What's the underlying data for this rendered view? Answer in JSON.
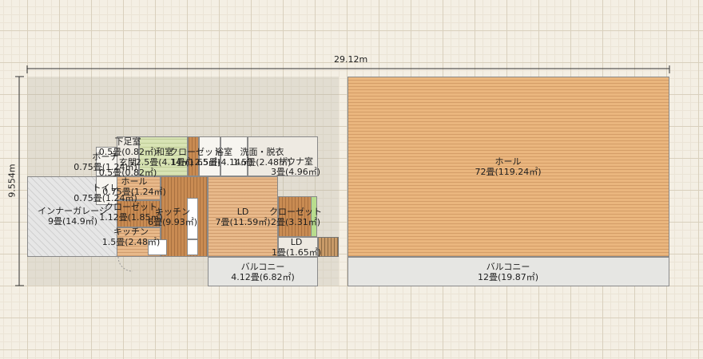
{
  "dimensions": {
    "width_label": "29.12m",
    "height_label": "9.554m"
  },
  "rooms": {
    "inner_garage": {
      "name": "インナーガレージ",
      "area": "9畳(14.9㎡)"
    },
    "toilet": {
      "name": "トイレ",
      "area": "0.75畳(1.24㎡)"
    },
    "porch": {
      "name": "ポーチ",
      "area": "0.75畳(1.24㎡)"
    },
    "shoe_room": {
      "name": "下足室",
      "area": "0.5畳(0.82㎡)"
    },
    "entrance": {
      "name": "玄関",
      "area": "0.5畳(0.82㎡)"
    },
    "hall_small": {
      "name": "ホール",
      "area": "0.75畳(1.24㎡)"
    },
    "closet_a": {
      "name": "クローゼット",
      "area": "1.12畳(1.85㎡)"
    },
    "kitchen_a": {
      "name": "キッチン",
      "area": "1.5畳(2.48㎡)"
    },
    "washitsu": {
      "name": "和室",
      "area": "2.5畳(4.14㎡)"
    },
    "closet_b": {
      "name": "クローゼット",
      "area": "1畳(1.65㎡)"
    },
    "bath": {
      "name": "浴室",
      "area": "2.5畳(4.14㎡)"
    },
    "washroom": {
      "name": "洗面・脱衣",
      "area": "1.5畳(2.48㎡)"
    },
    "sauna": {
      "name": "サウナ室",
      "area": "3畳(4.96㎡)"
    },
    "kitchen_b": {
      "name": "キッチン",
      "area": "6畳(9.93㎡)"
    },
    "ld_main": {
      "name": "LD",
      "area": "7畳(11.59㎡)"
    },
    "closet_c": {
      "name": "クローゼット",
      "area": "2畳(3.31㎡)"
    },
    "ld_small": {
      "name": "LD",
      "area": "1畳(1.65㎡)"
    },
    "balcony_a": {
      "name": "バルコニー",
      "area": "4.12畳(6.82㎡)"
    },
    "hall_big": {
      "name": "ホール",
      "area": "72畳(119.24㎡)"
    },
    "balcony_b": {
      "name": "バルコニー",
      "area": "12畳(19.87㎡)"
    }
  }
}
